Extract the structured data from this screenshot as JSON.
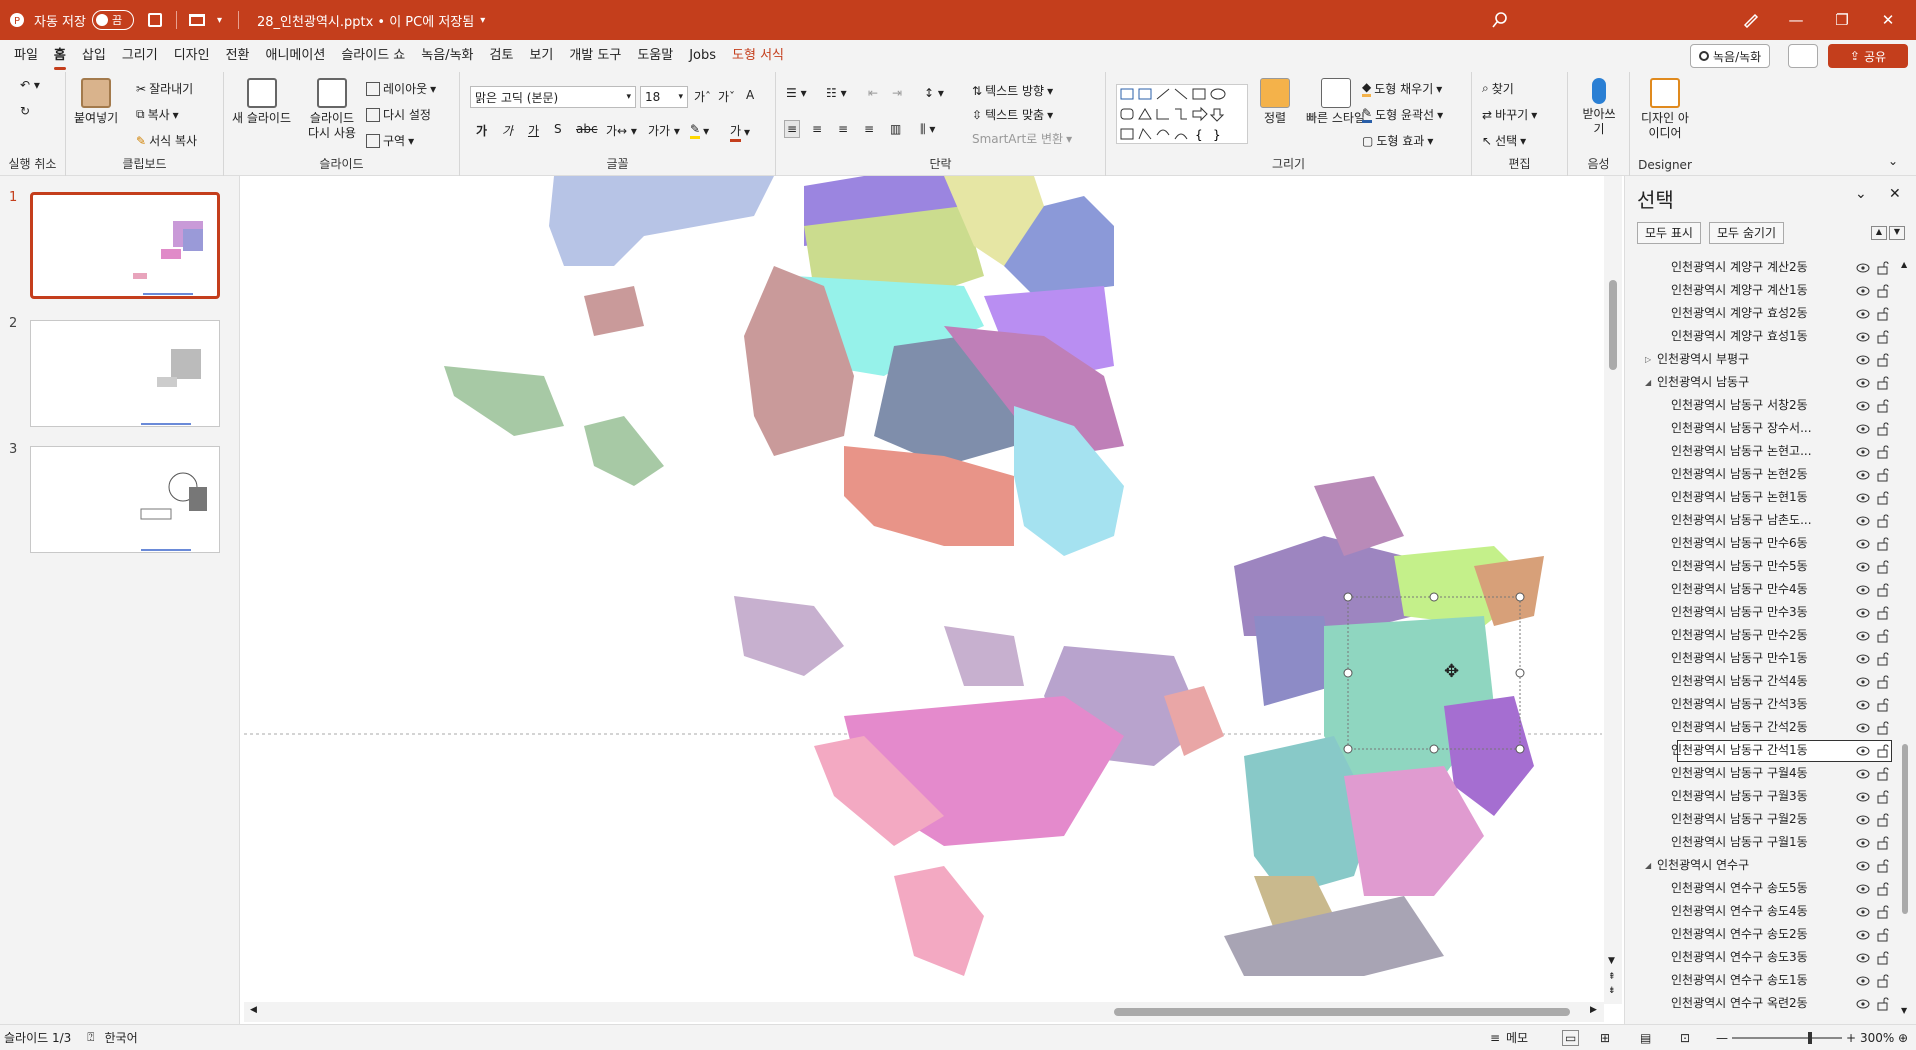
{
  "titlebar": {
    "autosave_label": "자동 저장",
    "autosave_state": "끔",
    "filename": "28_인천광역시.pptx • 이 PC에 저장됨",
    "minimize": "—",
    "restore": "❐",
    "close": "✕"
  },
  "menu": {
    "tabs": [
      "파일",
      "홈",
      "삽입",
      "그리기",
      "디자인",
      "전환",
      "애니메이션",
      "슬라이드 쇼",
      "녹음/녹화",
      "검토",
      "보기",
      "개발 도구",
      "도움말",
      "Jobs",
      "도형 서식"
    ],
    "active_tab": "홈",
    "record_button": "녹음/녹화",
    "share_button": "공유"
  },
  "ribbon": {
    "undo_group": "실행 취소",
    "clipboard": {
      "paste": "붙여넣기",
      "cut": "잘라내기",
      "copy": "복사",
      "format_painter": "서식 복사",
      "label": "클립보드"
    },
    "slides": {
      "new_slide": "새 슬라이드",
      "reuse": "슬라이드 다시 사용",
      "layout": "레이아웃",
      "reset": "다시 설정",
      "section": "구역",
      "label": "슬라이드"
    },
    "font": {
      "name": "맑은 고딕 (본문)",
      "size": "18",
      "label": "글꼴"
    },
    "paragraph": {
      "text_direction": "텍스트 방향",
      "align_text": "텍스트 맞춤",
      "smartart": "SmartArt로 변환",
      "label": "단락"
    },
    "drawing": {
      "arrange": "정렬",
      "quick_styles": "빠른 스타일",
      "fill": "도형 채우기",
      "outline": "도형 윤곽선",
      "effects": "도형 효과",
      "label": "그리기"
    },
    "editing": {
      "find": "찾기",
      "replace": "바꾸기",
      "select": "선택",
      "label": "편집"
    },
    "voice": {
      "dictate": "받아쓰기",
      "label": "음성"
    },
    "designer": {
      "ideas": "디자인 아이디어",
      "label": "Designer"
    }
  },
  "thumbnails": [
    {
      "num": "1"
    },
    {
      "num": "2"
    },
    {
      "num": "3"
    }
  ],
  "selection_pane": {
    "title": "선택",
    "show_all": "모두 표시",
    "hide_all": "모두 숨기기",
    "items": [
      {
        "label": "인천광역시 계양구 계산2동",
        "level": 2
      },
      {
        "label": "인천광역시 계양구 계산1동",
        "level": 2
      },
      {
        "label": "인천광역시 계양구 효성2동",
        "level": 2
      },
      {
        "label": "인천광역시 계양구 효성1동",
        "level": 2
      },
      {
        "label": "인천광역시 부평구",
        "level": 1,
        "expander": "▷"
      },
      {
        "label": "인천광역시 남동구",
        "level": 1,
        "expander": "◢"
      },
      {
        "label": "인천광역시 남동구 서창2동",
        "level": 2
      },
      {
        "label": "인천광역시 남동구 장수서...",
        "level": 2
      },
      {
        "label": "인천광역시 남동구 논현고...",
        "level": 2
      },
      {
        "label": "인천광역시 남동구 논현2동",
        "level": 2
      },
      {
        "label": "인천광역시 남동구 논현1동",
        "level": 2
      },
      {
        "label": "인천광역시 남동구 남촌도...",
        "level": 2
      },
      {
        "label": "인천광역시 남동구 만수6동",
        "level": 2
      },
      {
        "label": "인천광역시 남동구 만수5동",
        "level": 2
      },
      {
        "label": "인천광역시 남동구 만수4동",
        "level": 2
      },
      {
        "label": "인천광역시 남동구 만수3동",
        "level": 2
      },
      {
        "label": "인천광역시 남동구 만수2동",
        "level": 2
      },
      {
        "label": "인천광역시 남동구 만수1동",
        "level": 2
      },
      {
        "label": "인천광역시 남동구 간석4동",
        "level": 2
      },
      {
        "label": "인천광역시 남동구 간석3동",
        "level": 2
      },
      {
        "label": "인천광역시 남동구 간석2동",
        "level": 2
      },
      {
        "label": "인천광역시 남동구 간석1동",
        "level": 2,
        "selected": true
      },
      {
        "label": "인천광역시 남동구 구월4동",
        "level": 2
      },
      {
        "label": "인천광역시 남동구 구월3동",
        "level": 2
      },
      {
        "label": "인천광역시 남동구 구월2동",
        "level": 2
      },
      {
        "label": "인천광역시 남동구 구월1동",
        "level": 2
      },
      {
        "label": "인천광역시 연수구",
        "level": 1,
        "expander": "◢"
      },
      {
        "label": "인천광역시 연수구 송도5동",
        "level": 2
      },
      {
        "label": "인천광역시 연수구 송도4동",
        "level": 2
      },
      {
        "label": "인천광역시 연수구 송도2동",
        "level": 2
      },
      {
        "label": "인천광역시 연수구 송도3동",
        "level": 2
      },
      {
        "label": "인천광역시 연수구 송도1동",
        "level": 2
      },
      {
        "label": "인천광역시 연수구 옥련2동",
        "level": 2
      }
    ]
  },
  "status": {
    "slide": "슬라이드 1/3",
    "language": "한국어",
    "notes": "메모",
    "zoom": "300%"
  },
  "colors": {
    "accent": "#c43e1c"
  }
}
